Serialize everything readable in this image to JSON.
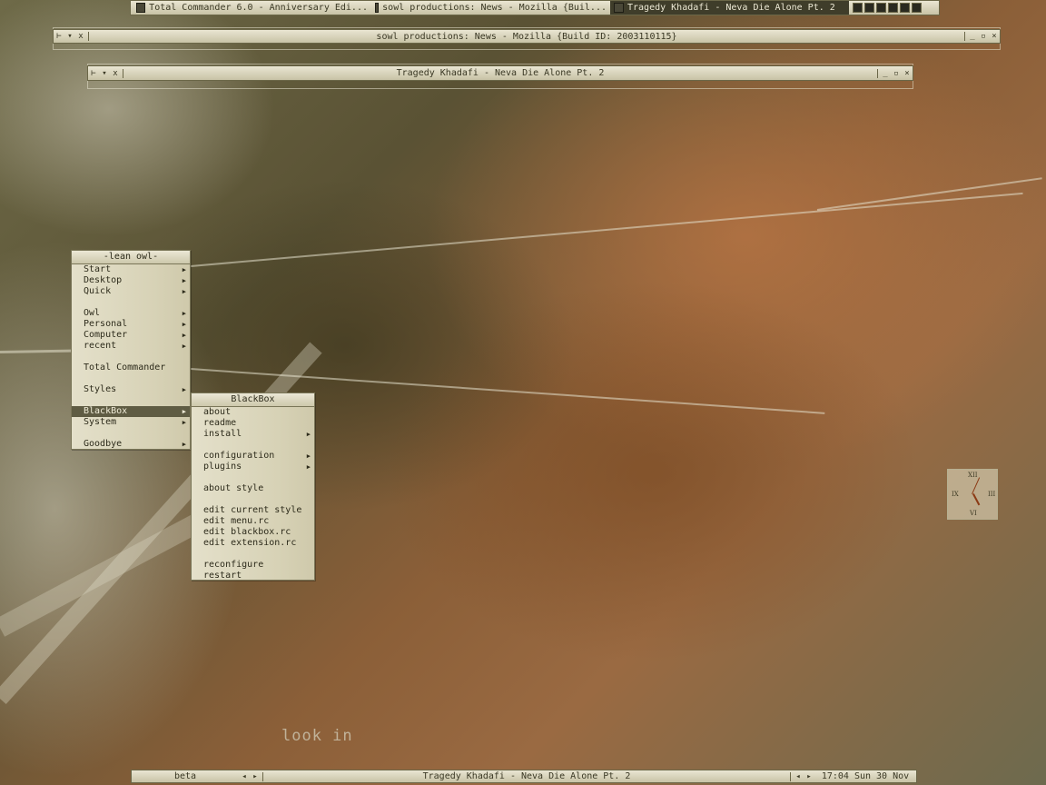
{
  "taskbar_top": {
    "tasks": [
      {
        "label": "Total Commander 6.0 - Anniversary Edi...",
        "active": false
      },
      {
        "label": "sowl productions: News - Mozilla {Buil...",
        "active": false
      },
      {
        "label": "Tragedy Khadafi - Neva Die Alone Pt. 2",
        "active": true
      }
    ]
  },
  "windows": {
    "mozilla": {
      "title": "sowl productions: News - Mozilla {Build ID: 2003110115}"
    },
    "tragedy": {
      "title": "Tragedy Khadafi - Neva Die Alone Pt. 2"
    }
  },
  "root_menu": {
    "title": "-lean owl-",
    "items": [
      "Start",
      "Desktop",
      "Quick",
      "Owl",
      "Personal",
      "Computer",
      "recent",
      "Total Commander",
      "Styles",
      "BlackBox",
      "System",
      "Goodbye"
    ]
  },
  "blackbox_menu": {
    "title": "BlackBox",
    "items": [
      "about",
      "readme",
      "install",
      "configuration",
      "plugins",
      "about style",
      "edit current style",
      "edit menu.rc",
      "edit blackbox.rc",
      "edit extension.rc",
      "reconfigure",
      "restart"
    ]
  },
  "clock": {
    "numerals": [
      "XII",
      "III",
      "VI",
      "IX"
    ],
    "time": "17:04"
  },
  "desktop_text": "look in",
  "taskbar_bottom": {
    "workspace": "beta",
    "window_label": "Tragedy Khadafi - Neva Die Alone Pt. 2",
    "clock_label": "17:04 Sun 30 Nov"
  }
}
